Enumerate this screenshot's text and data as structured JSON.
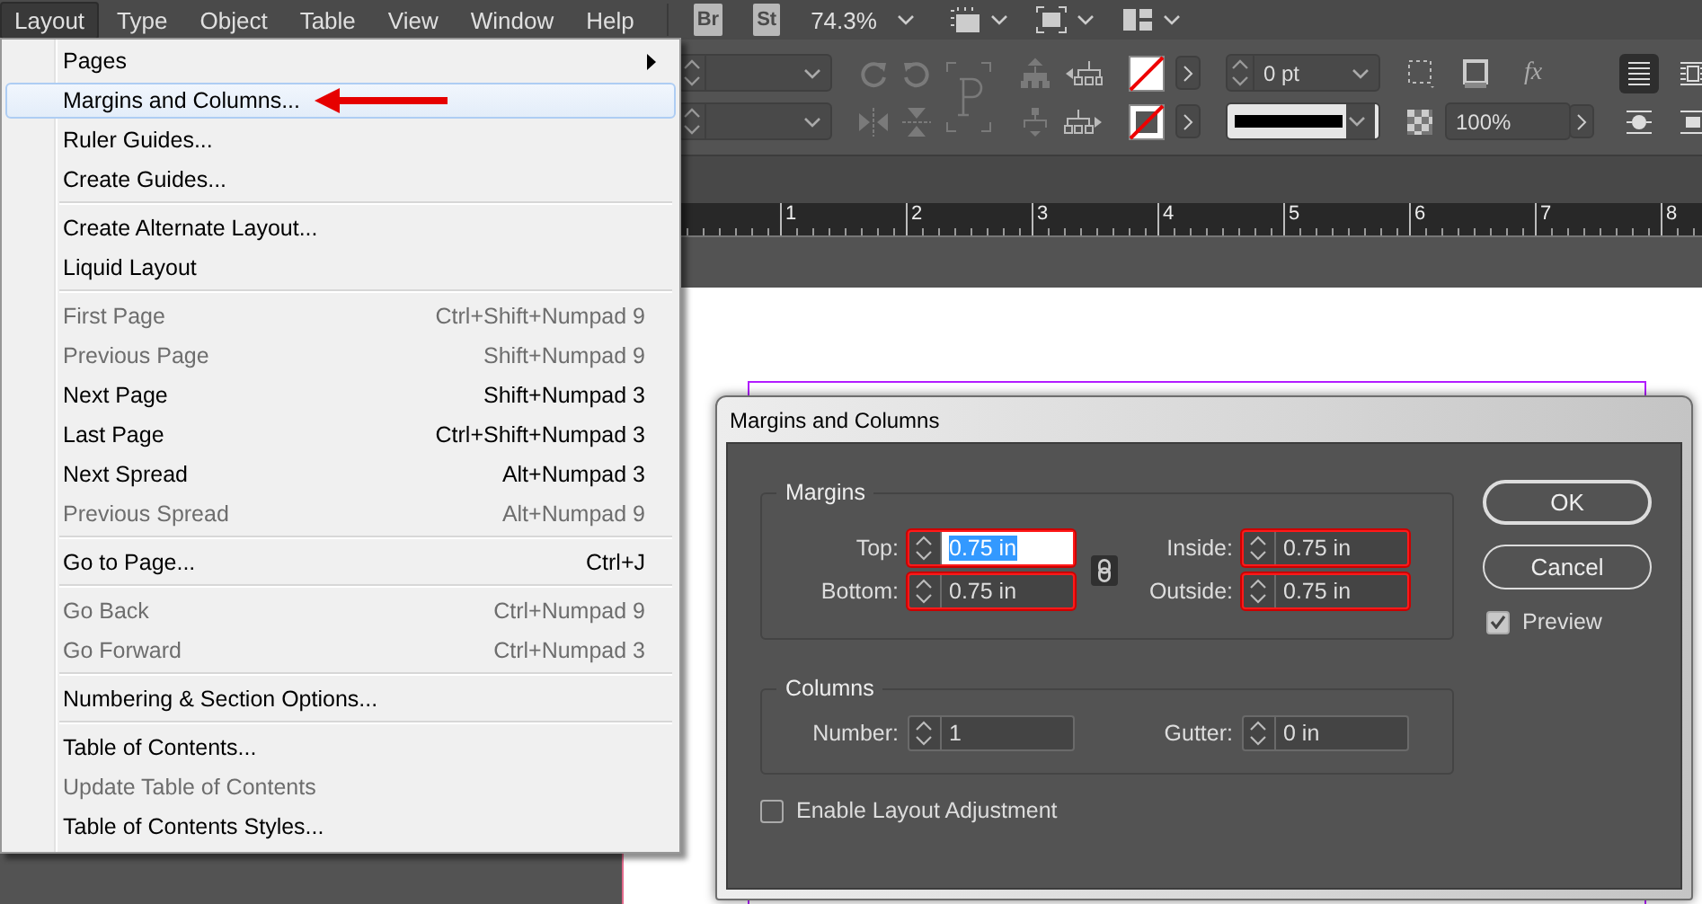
{
  "menu_bar": {
    "items": [
      {
        "label": "Layout",
        "selected": true
      },
      {
        "label": "Type",
        "selected": false
      },
      {
        "label": "Object",
        "selected": false
      },
      {
        "label": "Table",
        "selected": false
      },
      {
        "label": "View",
        "selected": false
      },
      {
        "label": "Window",
        "selected": false
      },
      {
        "label": "Help",
        "selected": false
      }
    ]
  },
  "app_bar": {
    "buttons": [
      "Br",
      "St"
    ],
    "zoom": "74.3%"
  },
  "control_panel": {
    "stroke_weight": "0 pt",
    "effects": "fx",
    "opacity": "100%"
  },
  "ruler": {
    "labels": [
      "1",
      "2",
      "3",
      "4",
      "5",
      "6",
      "7",
      "8"
    ]
  },
  "layout_menu": {
    "items": [
      {
        "kind": "submenu",
        "label": "Pages",
        "disabled": false,
        "selected": false
      },
      {
        "kind": "item",
        "label": "Margins and Columns...",
        "disabled": false,
        "selected": true
      },
      {
        "kind": "item",
        "label": "Ruler Guides...",
        "disabled": false,
        "selected": false
      },
      {
        "kind": "item",
        "label": "Create Guides...",
        "disabled": false,
        "selected": false
      },
      {
        "kind": "separator"
      },
      {
        "kind": "item",
        "label": "Create Alternate Layout...",
        "disabled": false,
        "selected": false
      },
      {
        "kind": "item",
        "label": "Liquid Layout",
        "disabled": false,
        "selected": false
      },
      {
        "kind": "separator"
      },
      {
        "kind": "item",
        "label": "First Page",
        "shortcut": "Ctrl+Shift+Numpad 9",
        "disabled": true,
        "selected": false
      },
      {
        "kind": "item",
        "label": "Previous Page",
        "shortcut": "Shift+Numpad 9",
        "disabled": true,
        "selected": false
      },
      {
        "kind": "item",
        "label": "Next Page",
        "shortcut": "Shift+Numpad 3",
        "disabled": false,
        "selected": false
      },
      {
        "kind": "item",
        "label": "Last Page",
        "shortcut": "Ctrl+Shift+Numpad 3",
        "disabled": false,
        "selected": false
      },
      {
        "kind": "item",
        "label": "Next Spread",
        "shortcut": "Alt+Numpad 3",
        "disabled": false,
        "selected": false
      },
      {
        "kind": "item",
        "label": "Previous Spread",
        "shortcut": "Alt+Numpad 9",
        "disabled": true,
        "selected": false
      },
      {
        "kind": "separator"
      },
      {
        "kind": "item",
        "label": "Go to Page...",
        "shortcut": "Ctrl+J",
        "disabled": false,
        "selected": false
      },
      {
        "kind": "separator"
      },
      {
        "kind": "item",
        "label": "Go Back",
        "shortcut": "Ctrl+Numpad 9",
        "disabled": true,
        "selected": false
      },
      {
        "kind": "item",
        "label": "Go Forward",
        "shortcut": "Ctrl+Numpad 3",
        "disabled": true,
        "selected": false
      },
      {
        "kind": "separator"
      },
      {
        "kind": "item",
        "label": "Numbering & Section Options...",
        "disabled": false,
        "selected": false
      },
      {
        "kind": "separator"
      },
      {
        "kind": "item",
        "label": "Table of Contents...",
        "disabled": false,
        "selected": false
      },
      {
        "kind": "item",
        "label": "Update Table of Contents",
        "disabled": true,
        "selected": false
      },
      {
        "kind": "item",
        "label": "Table of Contents Styles...",
        "disabled": false,
        "selected": false
      }
    ]
  },
  "dialog": {
    "title": "Margins and Columns",
    "margins": {
      "title": "Margins",
      "linked": true,
      "fields": [
        {
          "label": "Top:",
          "value": "0.75 in",
          "focused": true,
          "outlined": true
        },
        {
          "label": "Inside:",
          "value": "0.75 in",
          "focused": false,
          "outlined": true
        },
        {
          "label": "Bottom:",
          "value": "0.75 in",
          "focused": false,
          "outlined": true
        },
        {
          "label": "Outside:",
          "value": "0.75 in",
          "focused": false,
          "outlined": true
        }
      ]
    },
    "columns": {
      "title": "Columns",
      "fields": [
        {
          "label": "Number:",
          "value": "1",
          "focused": false,
          "outlined": false
        },
        {
          "label": "Gutter:",
          "value": "0 in",
          "focused": false,
          "outlined": false
        }
      ]
    },
    "layout_adjustment": {
      "label": "Enable Layout Adjustment",
      "checked": false
    },
    "buttons": [
      {
        "label": "OK",
        "default": true
      },
      {
        "label": "Cancel",
        "default": false
      }
    ],
    "preview": {
      "label": "Preview",
      "checked": true
    }
  }
}
